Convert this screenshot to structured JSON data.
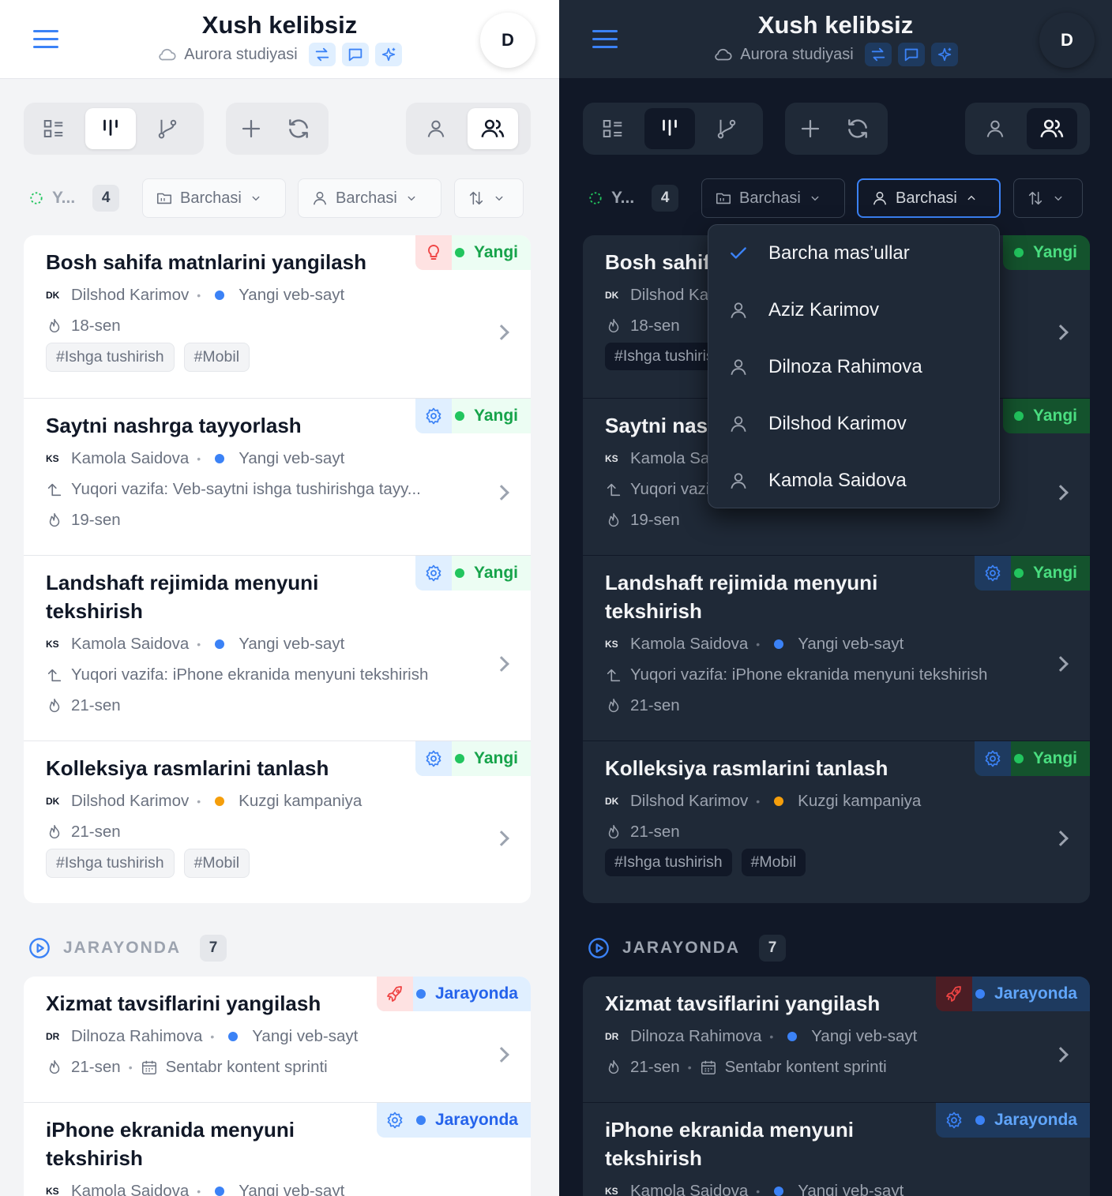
{
  "header": {
    "title": "Xush kelibsiz",
    "studio": "Aurora studiyasi",
    "avatar_letter": "D"
  },
  "filters": {
    "group_label": "Y...",
    "group_count": "4",
    "project_filter": "Barchasi",
    "assignee_filter": "Barchasi"
  },
  "groups": [
    {
      "label": "Y...",
      "count": "4",
      "tasks": [
        {
          "title": "Bosh sahifa matnlarini yangilash",
          "initials": "DK",
          "assignee": "Dilshod Karimov",
          "project": "Yangi veb-sayt",
          "project_color": "#3b82f6",
          "parent": "",
          "date": "18-sen",
          "sprint": "",
          "tags": [
            "#Ishga tushirish",
            "#Mobil"
          ],
          "badge_icon": "lightbulb-icon",
          "status": "Yangi"
        },
        {
          "title": "Saytni nashrga tayyorlash",
          "initials": "KS",
          "assignee": "Kamola Saidova",
          "project": "Yangi veb-sayt",
          "project_color": "#3b82f6",
          "parent": "Yuqori vazifa: Veb-saytni ishga tushirishga tayy...",
          "date": "19-sen",
          "sprint": "",
          "tags": [],
          "badge_icon": "gear-icon",
          "status": "Yangi"
        },
        {
          "title": "Landshaft rejimida menyuni tekshirish",
          "initials": "KS",
          "assignee": "Kamola Saidova",
          "project": "Yangi veb-sayt",
          "project_color": "#3b82f6",
          "parent": "Yuqori vazifa: iPhone ekranida menyuni tekshirish",
          "date": "21-sen",
          "sprint": "",
          "tags": [],
          "badge_icon": "gear-icon",
          "status": "Yangi"
        },
        {
          "title": "Kolleksiya rasmlarini tanlash",
          "initials": "DK",
          "assignee": "Dilshod Karimov",
          "project": "Kuzgi kampaniya",
          "project_color": "#f59e0b",
          "parent": "",
          "date": "21-sen",
          "sprint": "",
          "tags": [
            "#Ishga tushirish",
            "#Mobil"
          ],
          "badge_icon": "gear-icon",
          "status": "Yangi"
        }
      ]
    },
    {
      "label": "JARAYONDA",
      "count": "7",
      "tasks": [
        {
          "title": "Xizmat tavsiflarini yangilash",
          "initials": "DR",
          "assignee": "Dilnoza Rahimova",
          "project": "Yangi veb-sayt",
          "project_color": "#3b82f6",
          "parent": "",
          "date": "21-sen",
          "sprint": "Sentabr kontent sprinti",
          "tags": [],
          "badge_icon": "rocket-icon",
          "status": "Jarayonda"
        },
        {
          "title": "iPhone ekranida menyuni tekshirish",
          "initials": "KS",
          "assignee": "Kamola Saidova",
          "project": "Yangi veb-sayt",
          "project_color": "#3b82f6",
          "parent": "",
          "date": "",
          "sprint": "",
          "tags": [],
          "badge_icon": "gear-icon",
          "status": "Jarayonda"
        }
      ]
    }
  ],
  "assignee_menu": [
    {
      "label": "Barcha mas’ullar",
      "icon": "check-icon",
      "selected": true
    },
    {
      "label": "Aziz Karimov",
      "icon": "user-icon",
      "selected": false
    },
    {
      "label": "Dilnoza Rahimova",
      "icon": "user-icon",
      "selected": false
    },
    {
      "label": "Dilshod Karimov",
      "icon": "user-icon",
      "selected": false
    },
    {
      "label": "Kamola Saidova",
      "icon": "user-icon",
      "selected": false
    }
  ],
  "colors": {
    "accent": "#3b82f6",
    "status_new": "#16a34a",
    "status_progress": "#2563eb",
    "dark_bg": "#111827",
    "dark_surface": "#1f2937"
  }
}
